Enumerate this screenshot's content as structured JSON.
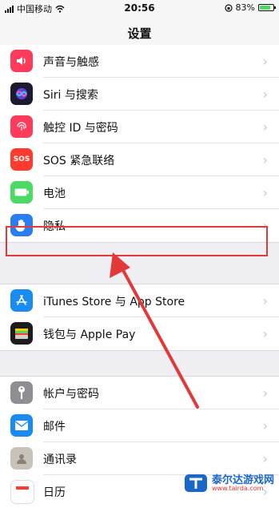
{
  "status": {
    "carrier": "中国移动",
    "time": "20:56",
    "battery": "83%",
    "battery_level": 0.83
  },
  "nav": {
    "title": "设置"
  },
  "group1": [
    {
      "label": "声音与触感",
      "icon": "speaker-icon",
      "color": "#ff3b5c"
    },
    {
      "label": "Siri 与搜索",
      "icon": "siri-icon",
      "color": "#1b1b2f"
    },
    {
      "label": "触控 ID 与密码",
      "icon": "fingerprint-icon",
      "color": "#ff3b5c"
    },
    {
      "label": "SOS 紧急联络",
      "icon": "sos-icon",
      "color": "#ff3b30"
    },
    {
      "label": "电池",
      "icon": "battery-icon",
      "color": "#4cd964"
    },
    {
      "label": "隐私",
      "icon": "hand-icon",
      "color": "#2b7ef2"
    }
  ],
  "group2": [
    {
      "label": "iTunes Store 与 App Store",
      "icon": "app-store-icon",
      "color": "#1a8cf0"
    },
    {
      "label": "钱包与 Apple Pay",
      "icon": "wallet-icon",
      "color": "#1c1c1e"
    }
  ],
  "group3": [
    {
      "label": "帐户与密码",
      "icon": "key-icon",
      "color": "#8e8e93"
    },
    {
      "label": "邮件",
      "icon": "mail-icon",
      "color": "#1a8cf0"
    },
    {
      "label": "通讯录",
      "icon": "contacts-icon",
      "color": "#c9c2b8"
    },
    {
      "label": "日历",
      "icon": "calendar-icon",
      "color": "#ffffff"
    }
  ],
  "watermark": {
    "name": "泰尔达游戏网",
    "url": "www.tairda.com"
  },
  "chevron": "›"
}
